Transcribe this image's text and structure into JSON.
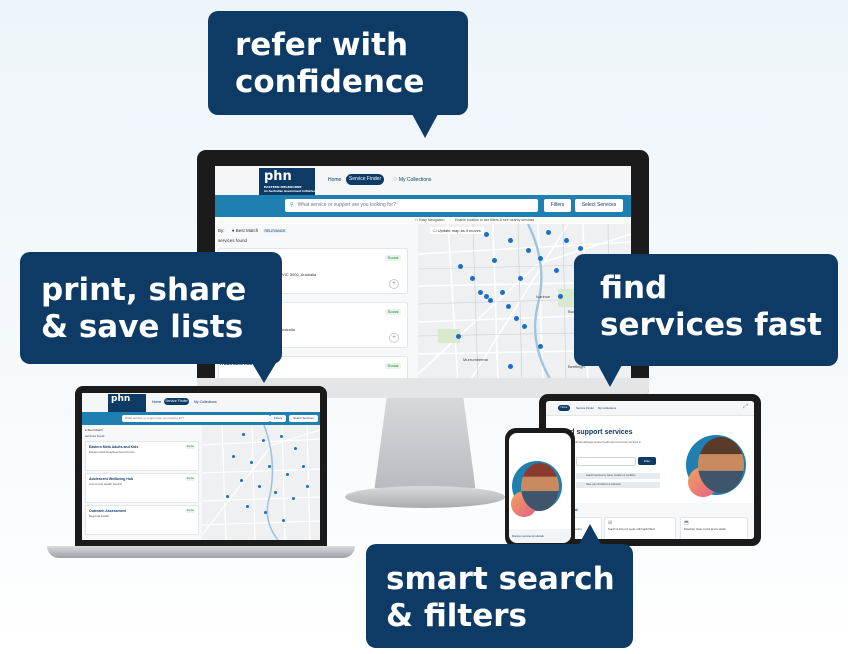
{
  "bubbles": {
    "refer": "refer with\nconfidence",
    "lists": "print, share\n& save lists",
    "find": "find\nservices fast",
    "search": "smart search\n& filters"
  },
  "brand": {
    "logo": "phn",
    "logo_sub": "EASTERN MELBOURNE",
    "logo_sub2": "An Australian Government Initiative"
  },
  "nav": {
    "home": "Home",
    "service_finder": "Service Finder",
    "collections": "My Collections"
  },
  "search": {
    "placeholder": "What service or support are you looking for?",
    "filters": "Filters",
    "select_services": "Select Services"
  },
  "options": {
    "easy_nav": "Easy Navigation",
    "hint": "Enable location to see filters & see nearby services"
  },
  "results": {
    "sort_by": "By:",
    "sort_value": "Best Match",
    "sort_badge": "RELEVANCE",
    "count_label": "services found",
    "map_label": "Update map as it moves"
  },
  "cards": [
    {
      "tag": "Social",
      "addr": "VIC 3000, Australia"
    },
    {
      "tag": "Social",
      "addr": "ustralia"
    },
    {
      "tag": "Social",
      "title": "Traumatic Management"
    }
  ],
  "laptop_cards": [
    {
      "title": "Eastern Melb Adults and Kids",
      "sub": "Eastern Melb Neighbourhood Centre"
    },
    {
      "title": "Adolescent Wellbeing Hub",
      "sub": "Community Health Service"
    },
    {
      "title": "Outreach Assessment",
      "sub": "Regional Health"
    }
  ],
  "map_labels": [
    "Ivanhoe",
    "Burwood",
    "Murrumbeena",
    "Bentleigh"
  ],
  "tablet": {
    "heading": "ind support services",
    "body": "Explore referral pathways across health and community services in your area",
    "filter_btn": "Filter",
    "hint1": "Search services by name, location or condition",
    "hint2": "Save your shortlist to a collection",
    "section": "re in ind",
    "feat1": "Service directory",
    "feat2": "Search to find your needs, with helpful filters",
    "feat3": "Download, share or print service details"
  },
  "phone": {
    "caption": "Discover services & referrals"
  },
  "colors": {
    "navy": "#0d3b66",
    "accent": "#1f7fb0",
    "pin": "#1e6fc3",
    "tag": "#2f7d3a"
  }
}
